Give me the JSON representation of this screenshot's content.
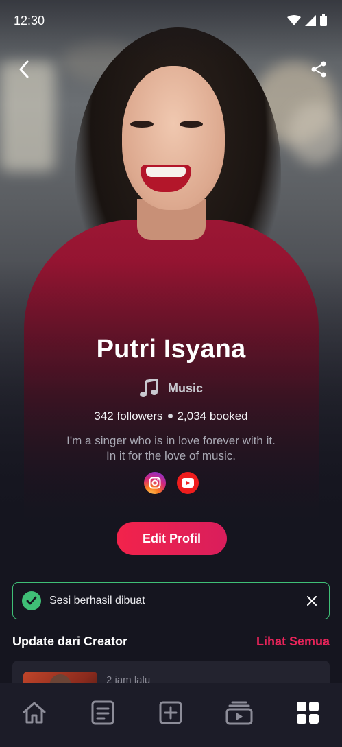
{
  "status_bar": {
    "time": "12:30",
    "icons": [
      "wifi-icon",
      "signal-icon",
      "battery-icon"
    ]
  },
  "header": {
    "back_icon": "chevron-left-icon",
    "share_icon": "share-icon"
  },
  "profile": {
    "name": "Putri Isyana",
    "category": "Music",
    "category_icon": "music-note-icon",
    "followers": "342 followers",
    "booked": "2,034 booked",
    "bio_line1": "I'm a singer who is in love forever with it.",
    "bio_line2": "In it for the love of music.",
    "socials": [
      "instagram-icon",
      "youtube-icon"
    ],
    "edit_label": "Edit Profil"
  },
  "toast": {
    "message": "Sesi berhasil dibuat",
    "color": "#3fbf76"
  },
  "updates": {
    "title": "Update dari Creator",
    "see_all": "Lihat Semua",
    "items": [
      {
        "time": "2 jam lalu"
      }
    ]
  },
  "bottom_nav": {
    "items": [
      "home-icon",
      "document-icon",
      "add-box-icon",
      "video-library-icon",
      "grid-icon"
    ],
    "active_index": 4
  },
  "colors": {
    "accent": "#e8245a",
    "background": "#15151f",
    "success": "#3fbf76"
  }
}
